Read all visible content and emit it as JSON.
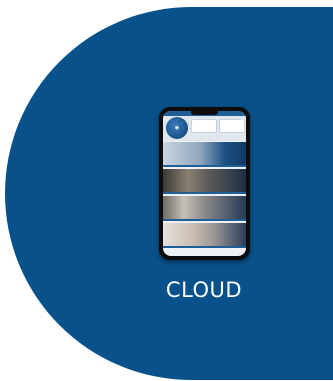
{
  "colors": {
    "background": "#ffffff",
    "brand_blue": "#08518a",
    "caption_text": "#ffffff"
  },
  "caption": {
    "label": "CLOUD"
  },
  "phone": {
    "header": {
      "logo_icon": "globe-logo-icon",
      "tabs": []
    },
    "rows": [
      {
        "image": "cloud-network-photo"
      },
      {
        "image": "office-people-photo"
      },
      {
        "image": "meeting-photo"
      },
      {
        "image": "hand-device-photo"
      }
    ]
  }
}
